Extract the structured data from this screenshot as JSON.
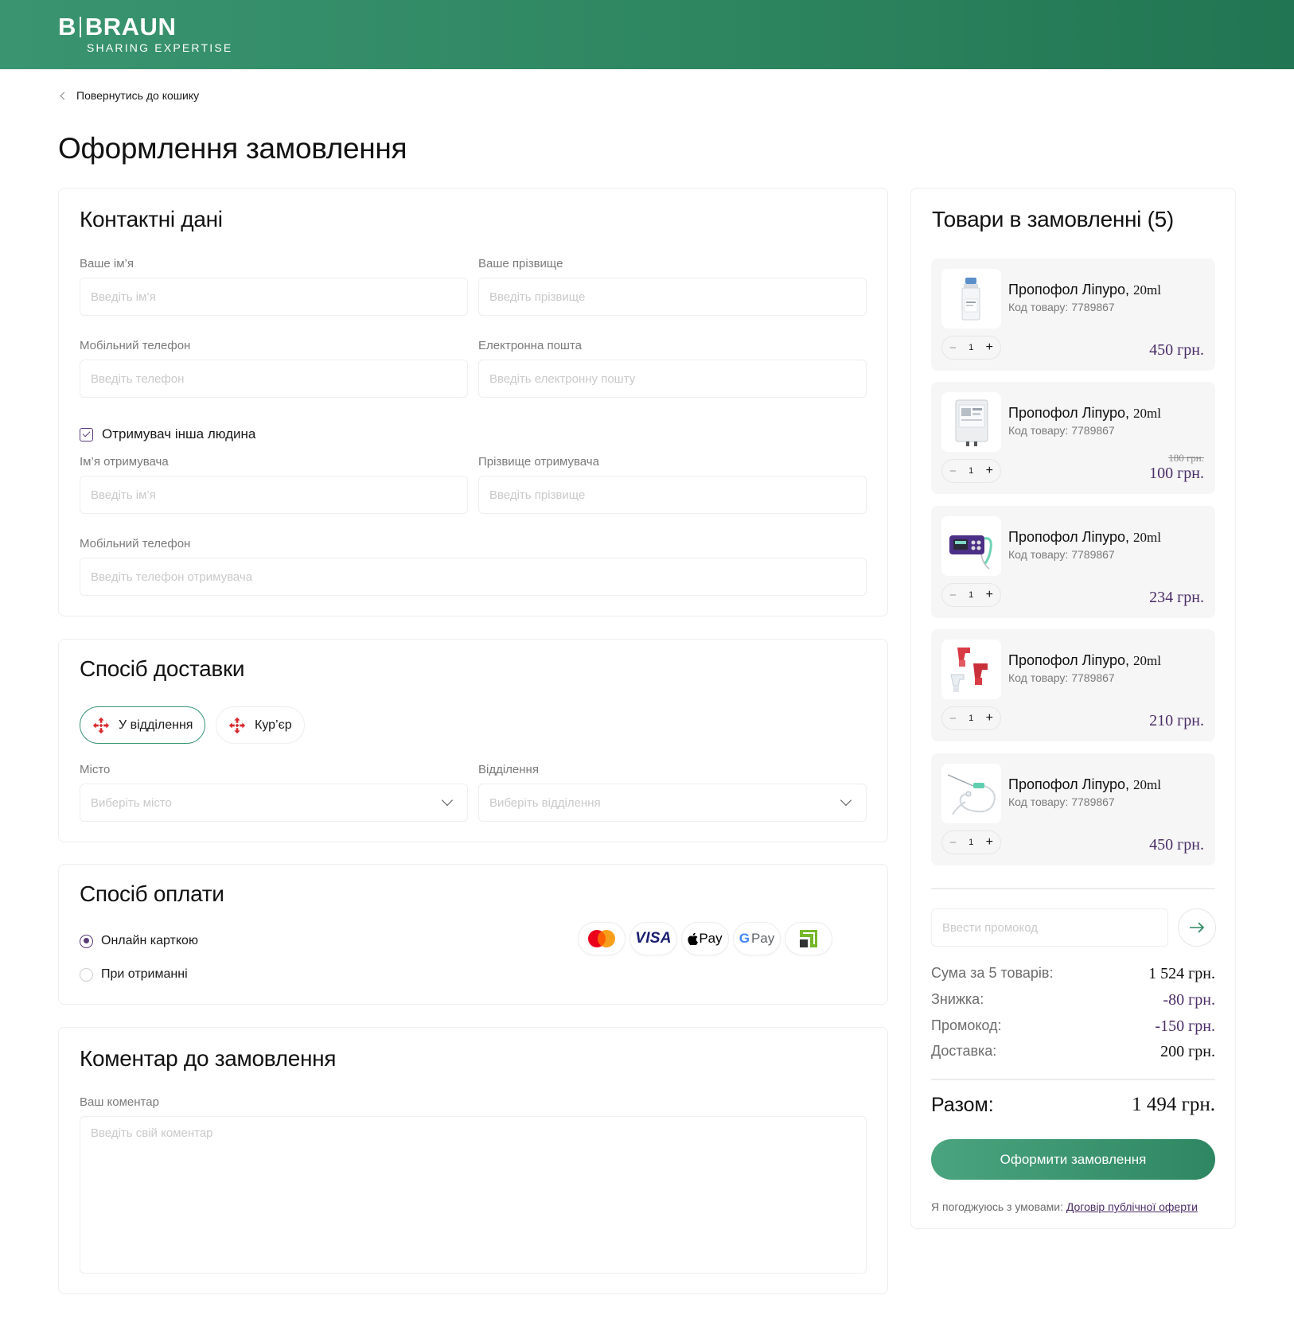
{
  "brand": {
    "name": "B|BRAUN",
    "name_left": "B",
    "name_right": "BRAUN",
    "tagline": "SHARING EXPERTISE"
  },
  "back_link": "Повернутись до кошику",
  "page_title": "Оформлення замовлення",
  "contact": {
    "title": "Контактні дані",
    "first_name": {
      "label": "Ваше ім’я",
      "placeholder": "Введіть ім’я"
    },
    "last_name": {
      "label": "Ваше прізвище",
      "placeholder": "Введіть прізвище"
    },
    "phone": {
      "label": "Мобільний телефон",
      "placeholder": "Введіть телефон"
    },
    "email": {
      "label": "Електронна пошта",
      "placeholder": "Введіть електронну пошту"
    },
    "other_recipient": {
      "label": "Отримувач інша людина",
      "checked": true
    },
    "recipient_first_name": {
      "label": "Ім’я отримувача",
      "placeholder": "Введіть ім’я"
    },
    "recipient_last_name": {
      "label": "Прізвище отримувача",
      "placeholder": "Введіть прізвище"
    },
    "recipient_phone": {
      "label": "Мобільний телефон",
      "placeholder": "Введіть телефон отримувача"
    }
  },
  "delivery": {
    "title": "Спосіб доставки",
    "options": [
      {
        "label": "У відділення",
        "icon": "nova-poshta-icon",
        "selected": true
      },
      {
        "label": "Кур’єр",
        "icon": "nova-poshta-icon",
        "selected": false
      }
    ],
    "city": {
      "label": "Місто",
      "placeholder": "Виберіть місто"
    },
    "branch": {
      "label": "Відділення",
      "placeholder": "Виберіть відділення"
    }
  },
  "payment": {
    "title": "Спосіб оплати",
    "options": [
      {
        "label": "Онлайн карткою",
        "selected": true
      },
      {
        "label": "При отриманні",
        "selected": false
      }
    ],
    "methods": [
      "mastercard-icon",
      "visa-icon",
      "apple-pay-icon",
      "google-pay-icon",
      "privatbank-icon"
    ],
    "visa_text": "VISA",
    "apple_pay_text": "Pay",
    "google_pay_text": "Pay"
  },
  "comment": {
    "title": "Коментар до замовлення",
    "label": "Ваш коментар",
    "placeholder": "Введіть свій коментар"
  },
  "cart": {
    "title": "Товари в замовленні",
    "count": "(5)",
    "items": [
      {
        "name": "Пропофол Ліпуро,",
        "volume": "20ml",
        "code": "Код товару: 7789867",
        "qty": "1",
        "price": "450 грн.",
        "old_price": "",
        "image": "vial"
      },
      {
        "name": "Пропофол Ліпуро,",
        "volume": "20ml",
        "code": "Код товару: 7789867",
        "qty": "1",
        "price": "100 грн.",
        "old_price": "180 грн.",
        "image": "infusion-bag"
      },
      {
        "name": "Пропофол Ліпуро,",
        "volume": "20ml",
        "code": "Код товару: 7789867",
        "qty": "1",
        "price": "234 грн.",
        "old_price": "",
        "image": "infusion-pump"
      },
      {
        "name": "Пропофол Ліпуро,",
        "volume": "20ml",
        "code": "Код товару: 7789867",
        "qty": "1",
        "price": "210 грн.",
        "old_price": "",
        "image": "spray-triggers"
      },
      {
        "name": "Пропофол Ліпуро,",
        "volume": "20ml",
        "code": "Код товару: 7789867",
        "qty": "1",
        "price": "450 грн.",
        "old_price": "",
        "image": "catheter-set"
      }
    ],
    "promo_placeholder": "Ввести промокод",
    "summary": [
      {
        "label": "Сума за 5 товарів:",
        "value": "1 524 грн."
      },
      {
        "label": "Знижка:",
        "value": "-80 грн."
      },
      {
        "label": "Промокод:",
        "value": "-150 грн."
      },
      {
        "label": "Доставка:",
        "value": "200 грн."
      }
    ],
    "total_label": "Разом:",
    "total_value": "1 494 грн.",
    "order_button": "Оформити замовлення",
    "terms_text": "Я погоджуюсь з умовами:",
    "terms_link": "Договір публічної оферти"
  },
  "colors": {
    "brand_green": "#2d8660",
    "accent_purple": "#4b2d67",
    "nova_poshta_red": "#d9262c"
  }
}
